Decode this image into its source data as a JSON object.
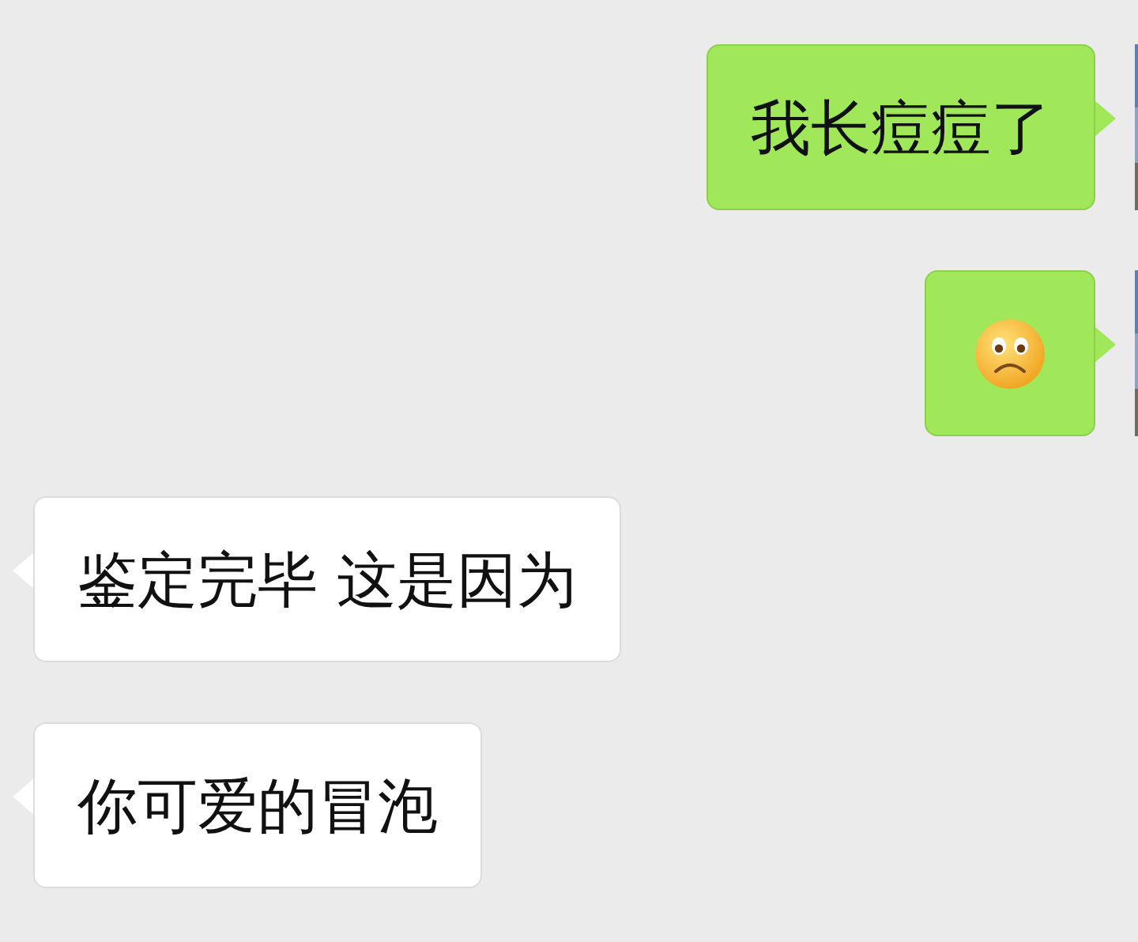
{
  "messages": [
    {
      "outgoing": true,
      "kind": "text",
      "text": "我长痘痘了"
    },
    {
      "outgoing": true,
      "kind": "emoji"
    },
    {
      "outgoing": false,
      "kind": "text",
      "text": "鉴定完毕 这是因为"
    },
    {
      "outgoing": false,
      "kind": "text",
      "text": "你可爱的冒泡"
    }
  ]
}
